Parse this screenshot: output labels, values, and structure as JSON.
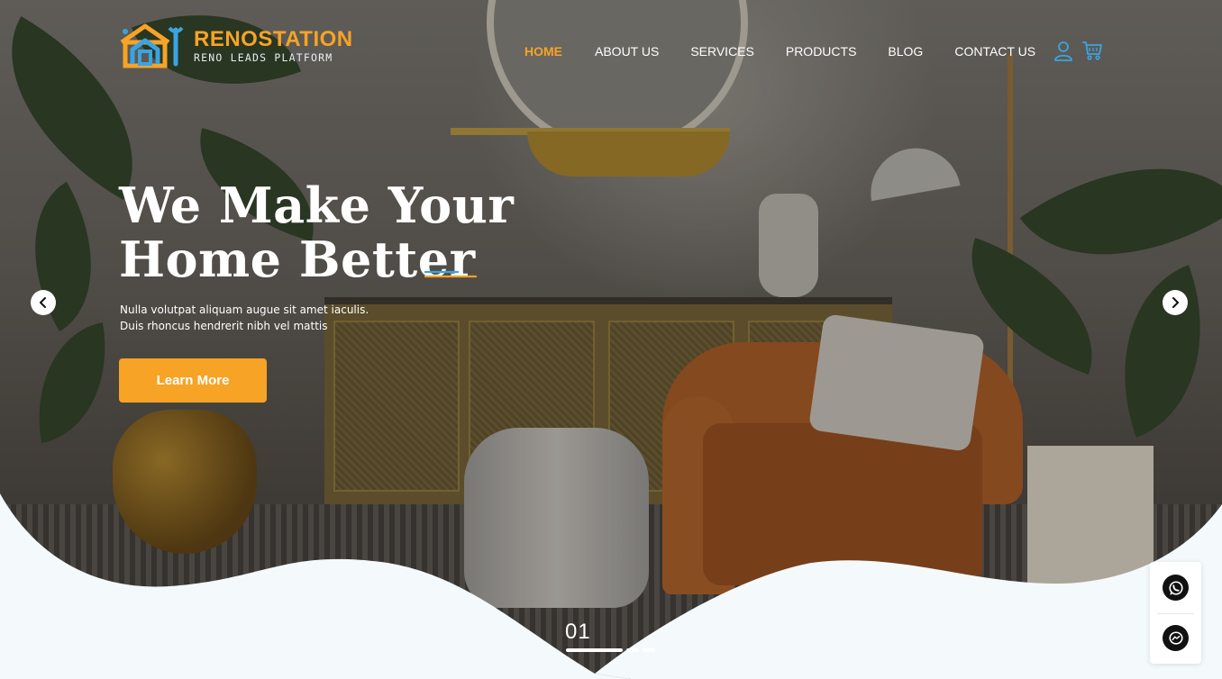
{
  "brand": {
    "name": "RENOSTATION",
    "tagline": "RENO LEADS PLATFORM",
    "colors": {
      "accent": "#f7a326",
      "blue": "#3ba4e0",
      "bg": "#f4f9fc"
    }
  },
  "nav": {
    "items": [
      {
        "label": "HOME",
        "active": true
      },
      {
        "label": "ABOUT US",
        "active": false
      },
      {
        "label": "SERVICES",
        "active": false
      },
      {
        "label": "PRODUCTS",
        "active": false
      },
      {
        "label": "BLOG",
        "active": false
      },
      {
        "label": "CONTACT US",
        "active": false
      }
    ],
    "icons": [
      "user-icon",
      "cart-icon"
    ]
  },
  "hero": {
    "title_line1": "We Make Your",
    "title_line2": "Home Better",
    "subtitle_line1": "Nulla volutpat aliquam augue sit amet iaculis.",
    "subtitle_line2": "Duis rhoncus hendrerit nibh vel mattis",
    "cta_label": "Learn More",
    "slide_number": "01",
    "slide_count": 3,
    "current_slide": 1
  },
  "carousel": {
    "prev_icon": "chevron-left-icon",
    "next_icon": "chevron-right-icon"
  },
  "social": {
    "items": [
      "whatsapp-icon",
      "messenger-icon"
    ]
  }
}
